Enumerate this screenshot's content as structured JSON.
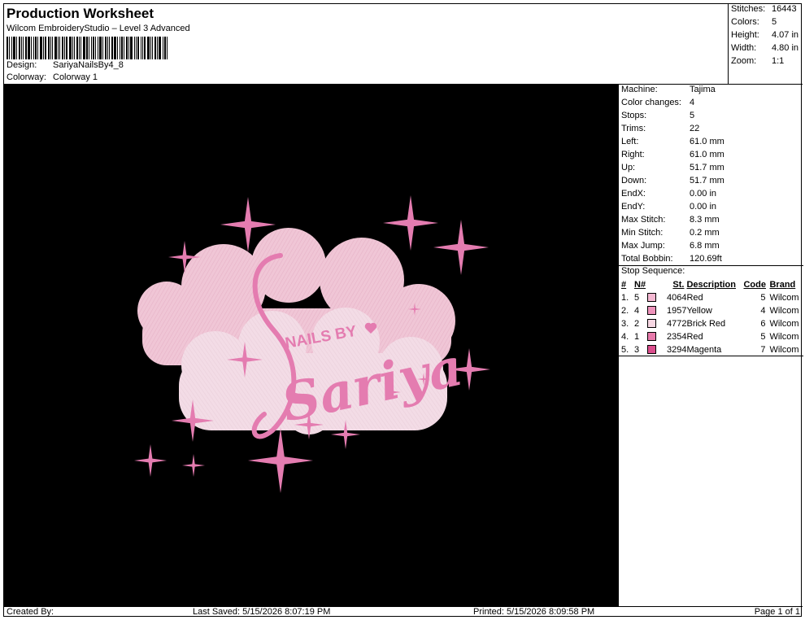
{
  "header": {
    "title": "Production Worksheet",
    "subtitle": "Wilcom EmbroideryStudio – Level 3 Advanced",
    "design_label": "Design:",
    "design_value": "SariyaNailsBy4_8",
    "colorway_label": "Colorway:",
    "colorway_value": "Colorway 1"
  },
  "stats": [
    {
      "label": "Stitches:",
      "value": "16443"
    },
    {
      "label": "Colors:",
      "value": "5"
    },
    {
      "label": "Height:",
      "value": "4.07 in"
    },
    {
      "label": "Width:",
      "value": "4.80 in"
    },
    {
      "label": "Zoom:",
      "value": "1:1"
    }
  ],
  "machine_info": [
    {
      "label": "Machine:",
      "value": "Tajima"
    },
    {
      "label": "Color changes:",
      "value": "4"
    },
    {
      "label": "Stops:",
      "value": "5"
    },
    {
      "label": "Trims:",
      "value": "22"
    },
    {
      "label": "Left:",
      "value": "61.0 mm"
    },
    {
      "label": "Right:",
      "value": "61.0 mm"
    },
    {
      "label": "Up:",
      "value": "51.7 mm"
    },
    {
      "label": "Down:",
      "value": "51.7 mm"
    },
    {
      "label": "EndX:",
      "value": "0.00 in"
    },
    {
      "label": "EndY:",
      "value": "0.00 in"
    },
    {
      "label": "Max Stitch:",
      "value": "8.3 mm"
    },
    {
      "label": "Min Stitch:",
      "value": "0.2 mm"
    },
    {
      "label": "Max Jump:",
      "value": "6.8 mm"
    },
    {
      "label": "Total Bobbin:",
      "value": "120.69ft"
    }
  ],
  "stop_sequence": {
    "title": "Stop Sequence:",
    "columns": [
      "#",
      "N#",
      "St.",
      "Description",
      "Code",
      "Brand"
    ],
    "rows": [
      {
        "idx": "1.",
        "n": "5",
        "st": "4064",
        "description": "Red",
        "code": "5",
        "brand": "Wilcom",
        "color": "#f4b8d2"
      },
      {
        "idx": "2.",
        "n": "4",
        "st": "1957",
        "description": "Yellow",
        "code": "4",
        "brand": "Wilcom",
        "color": "#ee93bb"
      },
      {
        "idx": "3.",
        "n": "2",
        "st": "4772",
        "description": "Brick Red",
        "code": "6",
        "brand": "Wilcom",
        "color": "#f7d7e3"
      },
      {
        "idx": "4.",
        "n": "1",
        "st": "2354",
        "description": "Red",
        "code": "5",
        "brand": "Wilcom",
        "color": "#e77aab"
      },
      {
        "idx": "5.",
        "n": "3",
        "st": "3294",
        "description": "Magenta",
        "code": "7",
        "brand": "Wilcom",
        "color": "#db4e8d"
      }
    ]
  },
  "design_art": {
    "small_text": "NAILS BY",
    "script_text": "Sariya",
    "background": "#000000",
    "cloud_back": "#f1c9d8",
    "cloud_front": "#f3dce6",
    "accent": "#e47cb0"
  },
  "footer": {
    "created_by": "Created By:",
    "last_saved": "Last Saved: 5/15/2026 8:07:19 PM",
    "printed": "Printed: 5/15/2026 8:09:58 PM",
    "page": "Page 1 of 1"
  }
}
